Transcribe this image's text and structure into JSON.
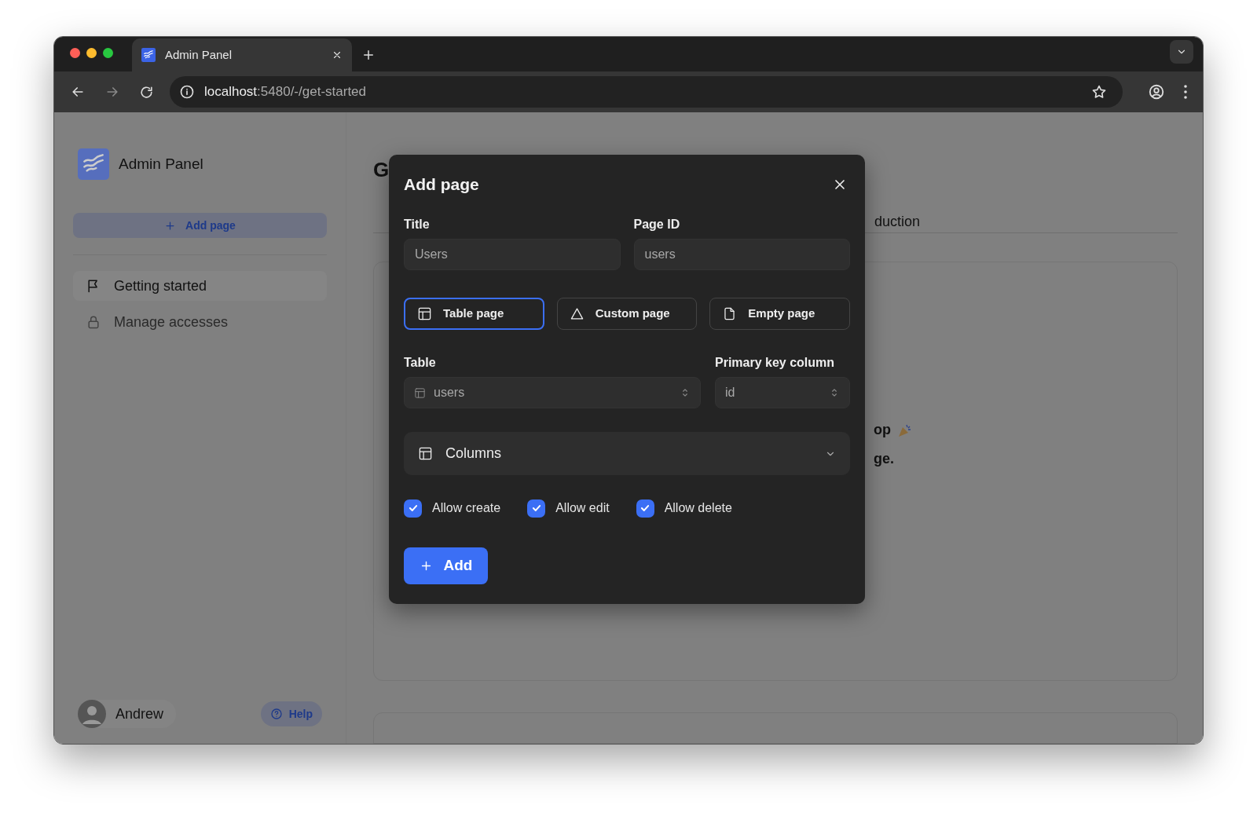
{
  "browser": {
    "tab": {
      "title": "Admin Panel",
      "selected": true
    },
    "url_host": "localhost",
    "url_path": ":5480/-/get-started"
  },
  "sidebar": {
    "app_name": "Admin Panel",
    "add_button": "Add page",
    "items": [
      {
        "label": "Getting started",
        "kind": "flag",
        "selected": true
      },
      {
        "label": "Manage accesses",
        "kind": "lock",
        "selected": false
      }
    ],
    "user": "Andrew",
    "help": "Help"
  },
  "main": {
    "heading": "G",
    "tab": "duction",
    "lines": [
      "op",
      "ge."
    ]
  },
  "dialog": {
    "title": "Add page",
    "fields": [
      {
        "label": "Title",
        "value": "Users"
      },
      {
        "label": "Page ID",
        "value": "users"
      }
    ],
    "page_types": [
      {
        "label": "Table page",
        "kind": "table",
        "selected": true
      },
      {
        "label": "Custom page",
        "kind": "custom",
        "selected": false
      },
      {
        "label": "Empty page",
        "kind": "empty",
        "selected": false
      }
    ],
    "selects": [
      {
        "label": "Table",
        "value": "users",
        "kind": "table"
      },
      {
        "label": "Primary key column",
        "value": "id",
        "kind": "plain"
      }
    ],
    "columns_section": {
      "label": "Columns",
      "expanded": false
    },
    "checkboxes": [
      {
        "label": "Allow create",
        "checked": true
      },
      {
        "label": "Allow edit",
        "checked": true
      },
      {
        "label": "Allow delete",
        "checked": true
      }
    ],
    "submit": "Add"
  }
}
